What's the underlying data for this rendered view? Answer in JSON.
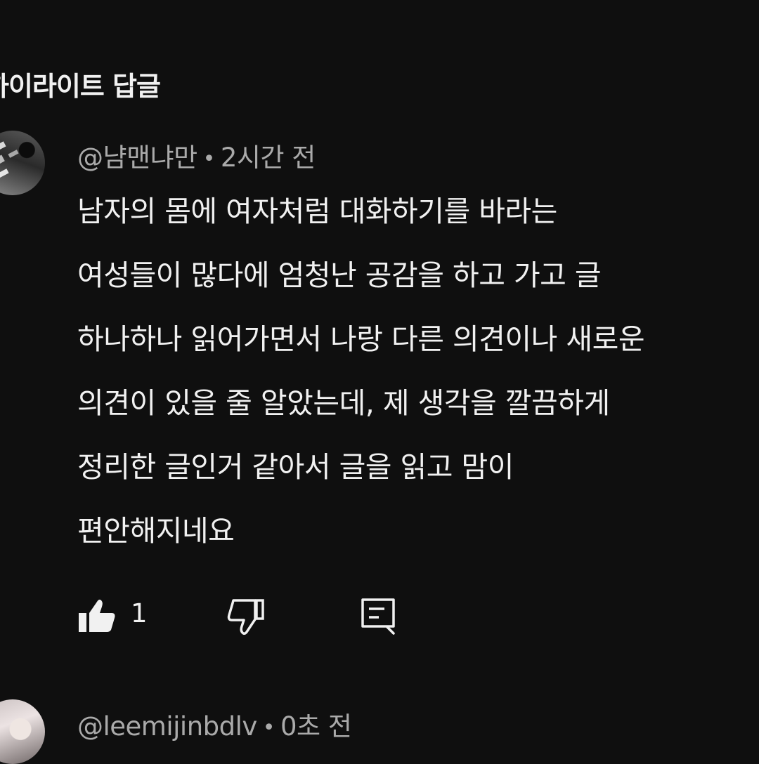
{
  "section": {
    "title": "하이라이트 답글"
  },
  "comments": [
    {
      "author": "@냠맨냐만",
      "separator": "•",
      "time": "2시간 전",
      "lines": [
        "남자의 몸에 여자처럼 대화하기를 바라는",
        "여성들이 많다에 엄청난 공감을 하고 가고 글",
        "하나하나 읽어가면서 나랑 다른 의견이나 새로운",
        "의견이 있을 줄 알았는데, 제 생각을 깔끔하게",
        "정리한 글인거 같아서 글을 읽고 맘이",
        "편안해지네요"
      ],
      "like_count": "1",
      "icons": {
        "like": "thumbs-up-icon",
        "dislike": "thumbs-down-icon",
        "reply": "reply-comment-icon"
      }
    },
    {
      "author": "@leemijinbdlv",
      "separator": "•",
      "time": "0초 전"
    }
  ]
}
